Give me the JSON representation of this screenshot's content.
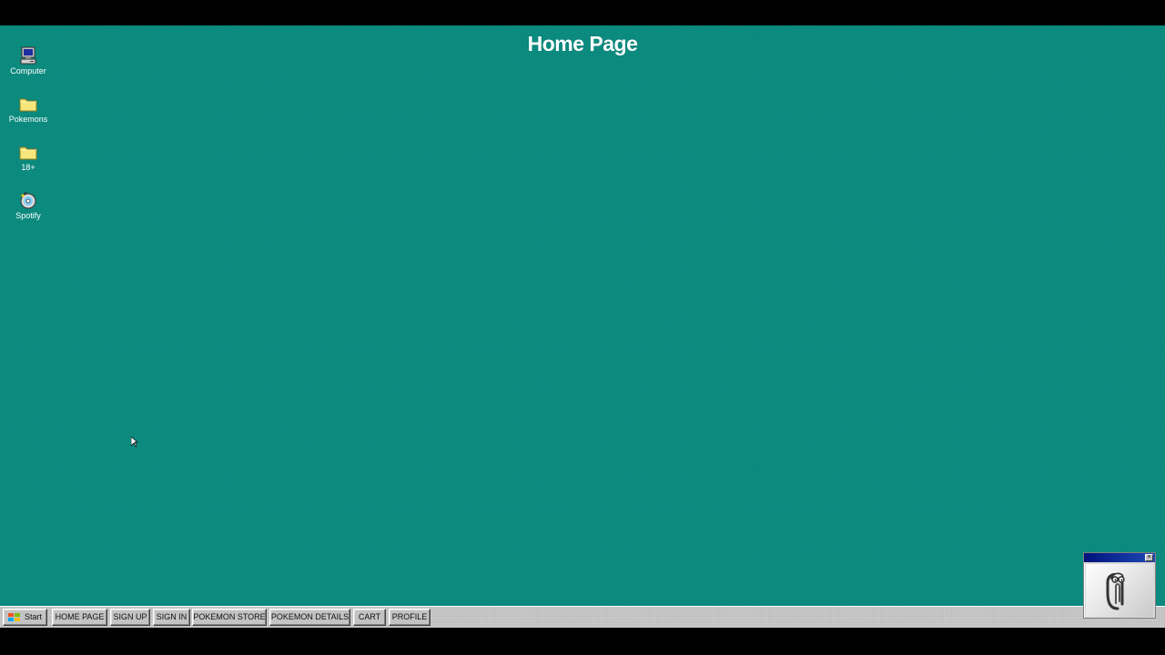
{
  "desktop": {
    "title": "Home Page",
    "background_color": "#0b8a7e",
    "icons": [
      {
        "label": "Computer",
        "icon": "computer-icon"
      },
      {
        "label": "Pokemons",
        "icon": "folder-icon"
      },
      {
        "label": "18+",
        "icon": "folder-icon"
      },
      {
        "label": "Spotify",
        "icon": "cd-player-icon"
      }
    ]
  },
  "taskbar": {
    "start_label": "Start",
    "buttons": [
      {
        "label": "HOME PAGE"
      },
      {
        "label": "SIGN UP"
      },
      {
        "label": "SIGN IN"
      },
      {
        "label": "POKEMON STORE"
      },
      {
        "label": "POKEMON DETAILS"
      },
      {
        "label": "CART"
      },
      {
        "label": "PROFILE"
      }
    ]
  },
  "assistant": {
    "icon": "paperclip-assistant-icon",
    "close_symbol": "×"
  }
}
